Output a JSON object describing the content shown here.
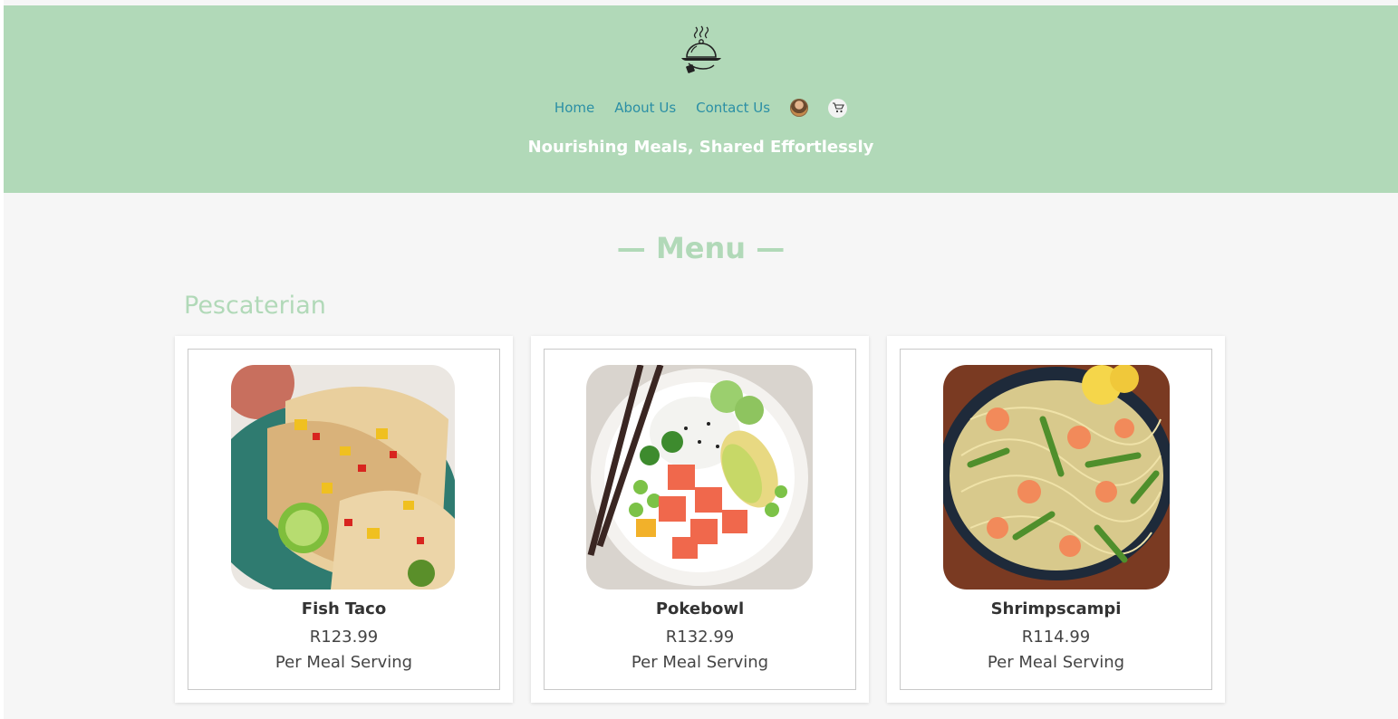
{
  "header": {
    "nav": {
      "home": "Home",
      "about": "About Us",
      "contact": "Contact Us"
    },
    "tagline": "Nourishing Meals, Shared Effortlessly"
  },
  "menu": {
    "title": "— Menu —",
    "category": "Pescaterian",
    "items": [
      {
        "name": "Fish Taco",
        "price": "R123.99",
        "unit": "Per Meal Serving"
      },
      {
        "name": "Pokebowl",
        "price": "R132.99",
        "unit": "Per Meal Serving"
      },
      {
        "name": "Shrimpscampi",
        "price": "R114.99",
        "unit": "Per Meal Serving"
      }
    ]
  },
  "colors": {
    "header_bg": "#b1d9b8",
    "nav_link": "#2b8fa5",
    "accent_text": "#b1d9b8"
  },
  "icons": [
    "cloche-logo-icon",
    "avatar-icon",
    "cart-icon"
  ]
}
